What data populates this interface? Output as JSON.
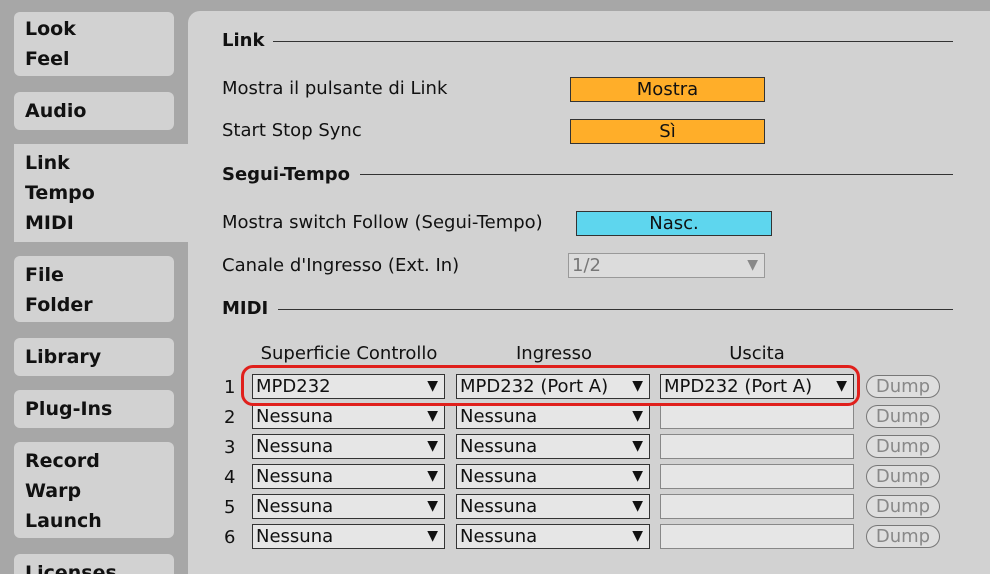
{
  "sidebar": {
    "tabs": [
      {
        "lines": [
          "Look",
          "Feel"
        ]
      },
      {
        "lines": [
          "Audio"
        ]
      },
      {
        "lines": [
          "Link",
          "Tempo",
          "MIDI"
        ]
      },
      {
        "lines": [
          "File",
          "Folder"
        ]
      },
      {
        "lines": [
          "Library"
        ]
      },
      {
        "lines": [
          "Plug-Ins"
        ]
      },
      {
        "lines": [
          "Record",
          "Warp",
          "Launch"
        ]
      },
      {
        "lines": [
          "Licenses"
        ]
      }
    ]
  },
  "link": {
    "title": "Link",
    "show_button_label": "Mostra il pulsante di Link",
    "show_button_value": "Mostra",
    "start_stop_label": "Start Stop Sync",
    "start_stop_value": "Sì"
  },
  "tempo": {
    "title": "Segui-Tempo",
    "follow_label": "Mostra switch Follow (Segui-Tempo)",
    "follow_value": "Nasc.",
    "channel_label": "Canale d'Ingresso (Ext. In)",
    "channel_value": "1/2"
  },
  "midi": {
    "title": "MIDI",
    "headers": {
      "surface": "Superficie Controllo",
      "input": "Ingresso",
      "output": "Uscita"
    },
    "dump_label": "Dump",
    "rows": [
      {
        "num": "1",
        "surface": "MPD232",
        "input": "MPD232 (Port A)",
        "output": "MPD232 (Port A)"
      },
      {
        "num": "2",
        "surface": "Nessuna",
        "input": "Nessuna",
        "output": ""
      },
      {
        "num": "3",
        "surface": "Nessuna",
        "input": "Nessuna",
        "output": ""
      },
      {
        "num": "4",
        "surface": "Nessuna",
        "input": "Nessuna",
        "output": ""
      },
      {
        "num": "5",
        "surface": "Nessuna",
        "input": "Nessuna",
        "output": ""
      },
      {
        "num": "6",
        "surface": "Nessuna",
        "input": "Nessuna",
        "output": ""
      }
    ]
  },
  "highlight_color": "#e0201c",
  "accent_orange": "#ffae29",
  "accent_cyan": "#5ed6ee"
}
